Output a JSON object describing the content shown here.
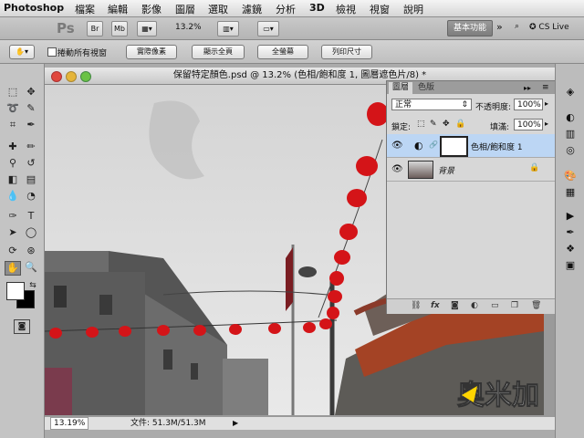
{
  "menubar": {
    "app": "Photoshop",
    "items": [
      "檔案",
      "編輯",
      "影像",
      "圖層",
      "選取",
      "濾鏡",
      "分析",
      "3D",
      "檢視",
      "視窗",
      "說明"
    ]
  },
  "appbar": {
    "zoom": "13.2%",
    "workspace": "基本功能",
    "cs_live": "CS Live"
  },
  "options": {
    "scroll_all": "捲動所有視窗",
    "buttons": [
      "實際像素",
      "顯示全頁",
      "全螢幕",
      "列印尺寸"
    ]
  },
  "document": {
    "title": "保留特定顏色.psd @ 13.2% (色相/飽和度 1, 圖層遮色片/8) *",
    "status_zoom": "13.19%",
    "status_file": "文件: 51.3M/51.3M",
    "watermark": "奧米加"
  },
  "layers_panel": {
    "tabs": [
      "圖層",
      "色版"
    ],
    "blend_mode": "正常",
    "opacity_label": "不透明度:",
    "opacity": "100%",
    "lock_label": "鎖定:",
    "fill_label": "填滿:",
    "fill": "100%",
    "layers": [
      {
        "name": "色相/飽和度 1",
        "selected": true
      },
      {
        "name": "背景",
        "selected": false
      }
    ]
  },
  "colors": {
    "accent_selection": "#bcd6f4",
    "lantern_red": "#d41418",
    "sky": "#dcdcdc"
  }
}
